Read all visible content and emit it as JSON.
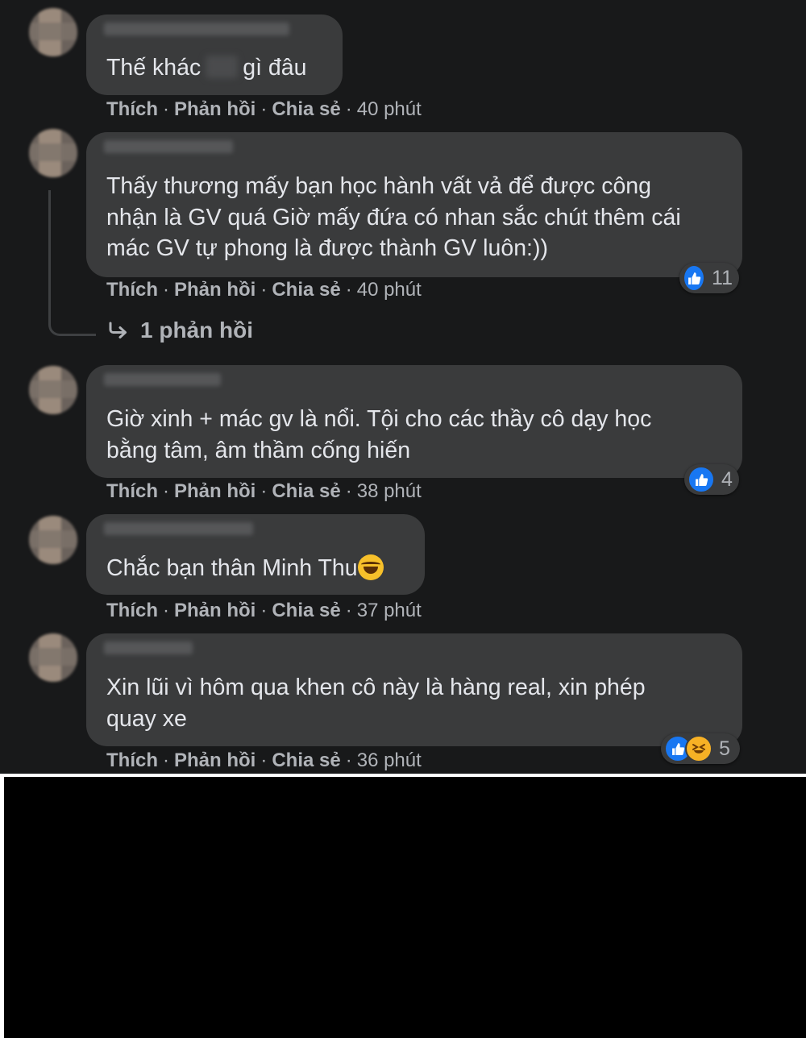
{
  "comments": [
    {
      "text": "gì đâu",
      "text_prefix": "Thế khác",
      "actions": {
        "like": "Thích",
        "reply": "Phản hồi",
        "share": "Chia sẻ",
        "time": "40 phút"
      }
    },
    {
      "text": "Thấy thương mấy bạn học hành vất vả để được công\nnhận là GV quá Giờ mấy đứa có nhan sắc chút thêm cái\nmác GV tự phong là được thành GV luôn:))",
      "actions": {
        "like": "Thích",
        "reply": "Phản hồi",
        "share": "Chia sẻ",
        "time": "40 phút"
      },
      "reactions": {
        "types": [
          "like"
        ],
        "count": "11"
      },
      "replies_link": "1 phản hồi"
    },
    {
      "text": "Giờ xinh + mác gv là nổi. Tội cho các thầy cô dạy học\nbằng tâm, âm thầm cống hiến",
      "actions": {
        "like": "Thích",
        "reply": "Phản hồi",
        "share": "Chia sẻ",
        "time": "38 phút"
      },
      "reactions": {
        "types": [
          "like"
        ],
        "count": "4"
      }
    },
    {
      "text": "Chắc bạn thân Minh Thu",
      "emoji": "laughing-tears",
      "actions": {
        "like": "Thích",
        "reply": "Phản hồi",
        "share": "Chia sẻ",
        "time": "37 phút"
      }
    },
    {
      "text": "Xin lũi vì hôm qua khen cô này là hàng real, xin phép\nquay xe",
      "actions": {
        "like": "Thích",
        "reply": "Phản hồi",
        "share": "Chia sẻ",
        "time": "36 phút"
      },
      "reactions": {
        "types": [
          "like",
          "haha"
        ],
        "count": "5"
      }
    }
  ],
  "colors": {
    "background": "#18191a",
    "bubble": "#3a3b3c",
    "text": "#e4e6eb",
    "meta_text": "#b0b3b8",
    "like_blue": "#1877f2",
    "haha_yellow": "#f7b125"
  }
}
